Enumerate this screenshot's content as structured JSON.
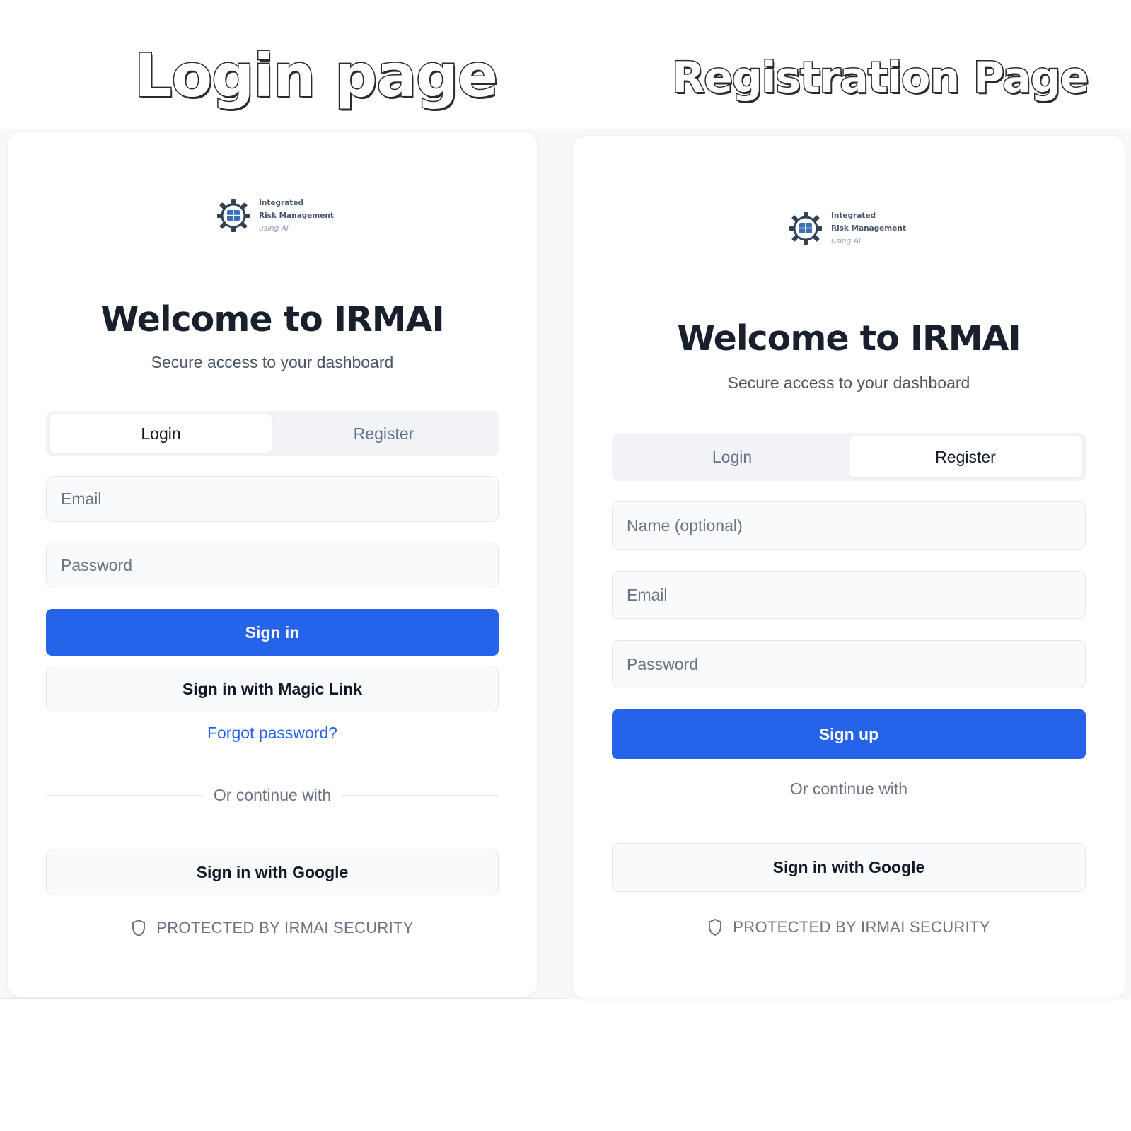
{
  "headings": {
    "login": "Login page",
    "register": "Registration Page"
  },
  "colors": {
    "primary": "#2563eb",
    "link": "#2563eb",
    "backdrop": "#f7f8fa",
    "card": "#ffffff"
  },
  "logo": {
    "line1": "Integrated",
    "line2": "Risk Management",
    "line3": "using AI",
    "mark": "IRM"
  },
  "login_card": {
    "title": "Welcome to IRMAI",
    "subtitle": "Secure access to your dashboard",
    "tabs": [
      {
        "label": "Login",
        "active": true
      },
      {
        "label": "Register",
        "active": false
      }
    ],
    "email_placeholder": "Email",
    "password_placeholder": "Password",
    "sign_in_label": "Sign in",
    "magic_link_label": "Sign in with Magic Link",
    "forgot_label": "Forgot password?",
    "divider_label": "Or continue with",
    "google_label": "Sign in with Google",
    "footer_label": "PROTECTED BY IRMAI SECURITY",
    "footer_icon": "shield-icon"
  },
  "register_card": {
    "title": "Welcome to IRMAI",
    "subtitle": "Secure access to your dashboard",
    "tabs": [
      {
        "label": "Login",
        "active": false
      },
      {
        "label": "Register",
        "active": true
      }
    ],
    "name_placeholder": "Name (optional)",
    "email_placeholder": "Email",
    "password_placeholder": "Password",
    "sign_up_label": "Sign up",
    "divider_label": "Or continue with",
    "google_label": "Sign in with Google",
    "footer_label": "PROTECTED BY IRMAI SECURITY",
    "footer_icon": "shield-icon"
  }
}
